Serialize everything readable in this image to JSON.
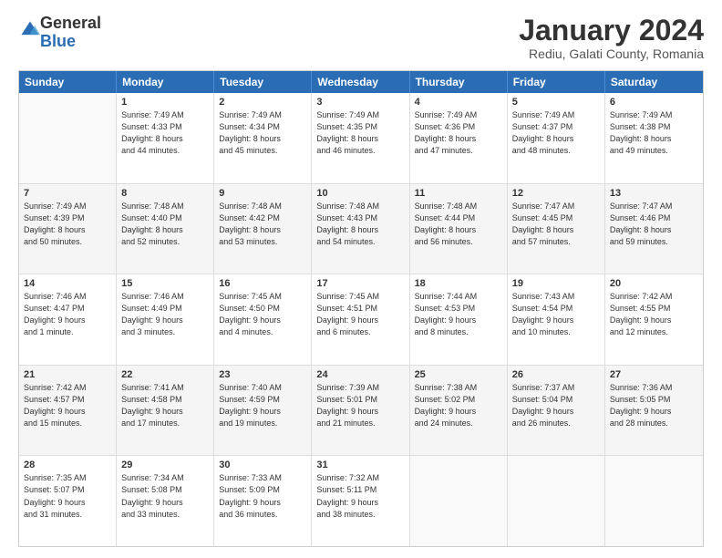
{
  "logo": {
    "general": "General",
    "blue": "Blue"
  },
  "header": {
    "month_title": "January 2024",
    "location": "Rediu, Galati County, Romania"
  },
  "weekdays": [
    "Sunday",
    "Monday",
    "Tuesday",
    "Wednesday",
    "Thursday",
    "Friday",
    "Saturday"
  ],
  "weeks": [
    [
      {
        "day": "",
        "info": ""
      },
      {
        "day": "1",
        "info": "Sunrise: 7:49 AM\nSunset: 4:33 PM\nDaylight: 8 hours\nand 44 minutes."
      },
      {
        "day": "2",
        "info": "Sunrise: 7:49 AM\nSunset: 4:34 PM\nDaylight: 8 hours\nand 45 minutes."
      },
      {
        "day": "3",
        "info": "Sunrise: 7:49 AM\nSunset: 4:35 PM\nDaylight: 8 hours\nand 46 minutes."
      },
      {
        "day": "4",
        "info": "Sunrise: 7:49 AM\nSunset: 4:36 PM\nDaylight: 8 hours\nand 47 minutes."
      },
      {
        "day": "5",
        "info": "Sunrise: 7:49 AM\nSunset: 4:37 PM\nDaylight: 8 hours\nand 48 minutes."
      },
      {
        "day": "6",
        "info": "Sunrise: 7:49 AM\nSunset: 4:38 PM\nDaylight: 8 hours\nand 49 minutes."
      }
    ],
    [
      {
        "day": "7",
        "info": "Sunrise: 7:49 AM\nSunset: 4:39 PM\nDaylight: 8 hours\nand 50 minutes."
      },
      {
        "day": "8",
        "info": "Sunrise: 7:48 AM\nSunset: 4:40 PM\nDaylight: 8 hours\nand 52 minutes."
      },
      {
        "day": "9",
        "info": "Sunrise: 7:48 AM\nSunset: 4:42 PM\nDaylight: 8 hours\nand 53 minutes."
      },
      {
        "day": "10",
        "info": "Sunrise: 7:48 AM\nSunset: 4:43 PM\nDaylight: 8 hours\nand 54 minutes."
      },
      {
        "day": "11",
        "info": "Sunrise: 7:48 AM\nSunset: 4:44 PM\nDaylight: 8 hours\nand 56 minutes."
      },
      {
        "day": "12",
        "info": "Sunrise: 7:47 AM\nSunset: 4:45 PM\nDaylight: 8 hours\nand 57 minutes."
      },
      {
        "day": "13",
        "info": "Sunrise: 7:47 AM\nSunset: 4:46 PM\nDaylight: 8 hours\nand 59 minutes."
      }
    ],
    [
      {
        "day": "14",
        "info": "Sunrise: 7:46 AM\nSunset: 4:47 PM\nDaylight: 9 hours\nand 1 minute."
      },
      {
        "day": "15",
        "info": "Sunrise: 7:46 AM\nSunset: 4:49 PM\nDaylight: 9 hours\nand 3 minutes."
      },
      {
        "day": "16",
        "info": "Sunrise: 7:45 AM\nSunset: 4:50 PM\nDaylight: 9 hours\nand 4 minutes."
      },
      {
        "day": "17",
        "info": "Sunrise: 7:45 AM\nSunset: 4:51 PM\nDaylight: 9 hours\nand 6 minutes."
      },
      {
        "day": "18",
        "info": "Sunrise: 7:44 AM\nSunset: 4:53 PM\nDaylight: 9 hours\nand 8 minutes."
      },
      {
        "day": "19",
        "info": "Sunrise: 7:43 AM\nSunset: 4:54 PM\nDaylight: 9 hours\nand 10 minutes."
      },
      {
        "day": "20",
        "info": "Sunrise: 7:42 AM\nSunset: 4:55 PM\nDaylight: 9 hours\nand 12 minutes."
      }
    ],
    [
      {
        "day": "21",
        "info": "Sunrise: 7:42 AM\nSunset: 4:57 PM\nDaylight: 9 hours\nand 15 minutes."
      },
      {
        "day": "22",
        "info": "Sunrise: 7:41 AM\nSunset: 4:58 PM\nDaylight: 9 hours\nand 17 minutes."
      },
      {
        "day": "23",
        "info": "Sunrise: 7:40 AM\nSunset: 4:59 PM\nDaylight: 9 hours\nand 19 minutes."
      },
      {
        "day": "24",
        "info": "Sunrise: 7:39 AM\nSunset: 5:01 PM\nDaylight: 9 hours\nand 21 minutes."
      },
      {
        "day": "25",
        "info": "Sunrise: 7:38 AM\nSunset: 5:02 PM\nDaylight: 9 hours\nand 24 minutes."
      },
      {
        "day": "26",
        "info": "Sunrise: 7:37 AM\nSunset: 5:04 PM\nDaylight: 9 hours\nand 26 minutes."
      },
      {
        "day": "27",
        "info": "Sunrise: 7:36 AM\nSunset: 5:05 PM\nDaylight: 9 hours\nand 28 minutes."
      }
    ],
    [
      {
        "day": "28",
        "info": "Sunrise: 7:35 AM\nSunset: 5:07 PM\nDaylight: 9 hours\nand 31 minutes."
      },
      {
        "day": "29",
        "info": "Sunrise: 7:34 AM\nSunset: 5:08 PM\nDaylight: 9 hours\nand 33 minutes."
      },
      {
        "day": "30",
        "info": "Sunrise: 7:33 AM\nSunset: 5:09 PM\nDaylight: 9 hours\nand 36 minutes."
      },
      {
        "day": "31",
        "info": "Sunrise: 7:32 AM\nSunset: 5:11 PM\nDaylight: 9 hours\nand 38 minutes."
      },
      {
        "day": "",
        "info": ""
      },
      {
        "day": "",
        "info": ""
      },
      {
        "day": "",
        "info": ""
      }
    ]
  ]
}
